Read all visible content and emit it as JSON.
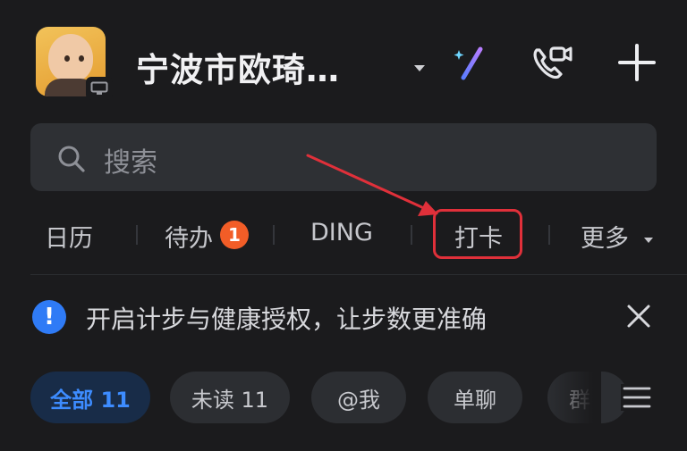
{
  "header": {
    "title": "宁波市欧琦…",
    "icons": [
      "dropdown-caret-icon",
      "ai-magic-wand-icon",
      "video-call-icon",
      "add-icon"
    ]
  },
  "search": {
    "placeholder": "搜索"
  },
  "tabs": [
    {
      "label": "日历"
    },
    {
      "label": "待办",
      "badge": "1"
    },
    {
      "label": "DING"
    },
    {
      "label": "打卡",
      "highlighted": true
    },
    {
      "label": "更多"
    }
  ],
  "notice": {
    "text": "开启计步与健康授权，让步数更准确"
  },
  "filters": [
    {
      "label": "全部 11",
      "active": true
    },
    {
      "label": "未读 11"
    },
    {
      "label": "@我"
    },
    {
      "label": "单聊"
    },
    {
      "label": "群"
    }
  ],
  "colors": {
    "background": "#1b1b1d",
    "accent": "#3d8cff",
    "badge": "#f25d27",
    "annotation": "#e0303a"
  }
}
